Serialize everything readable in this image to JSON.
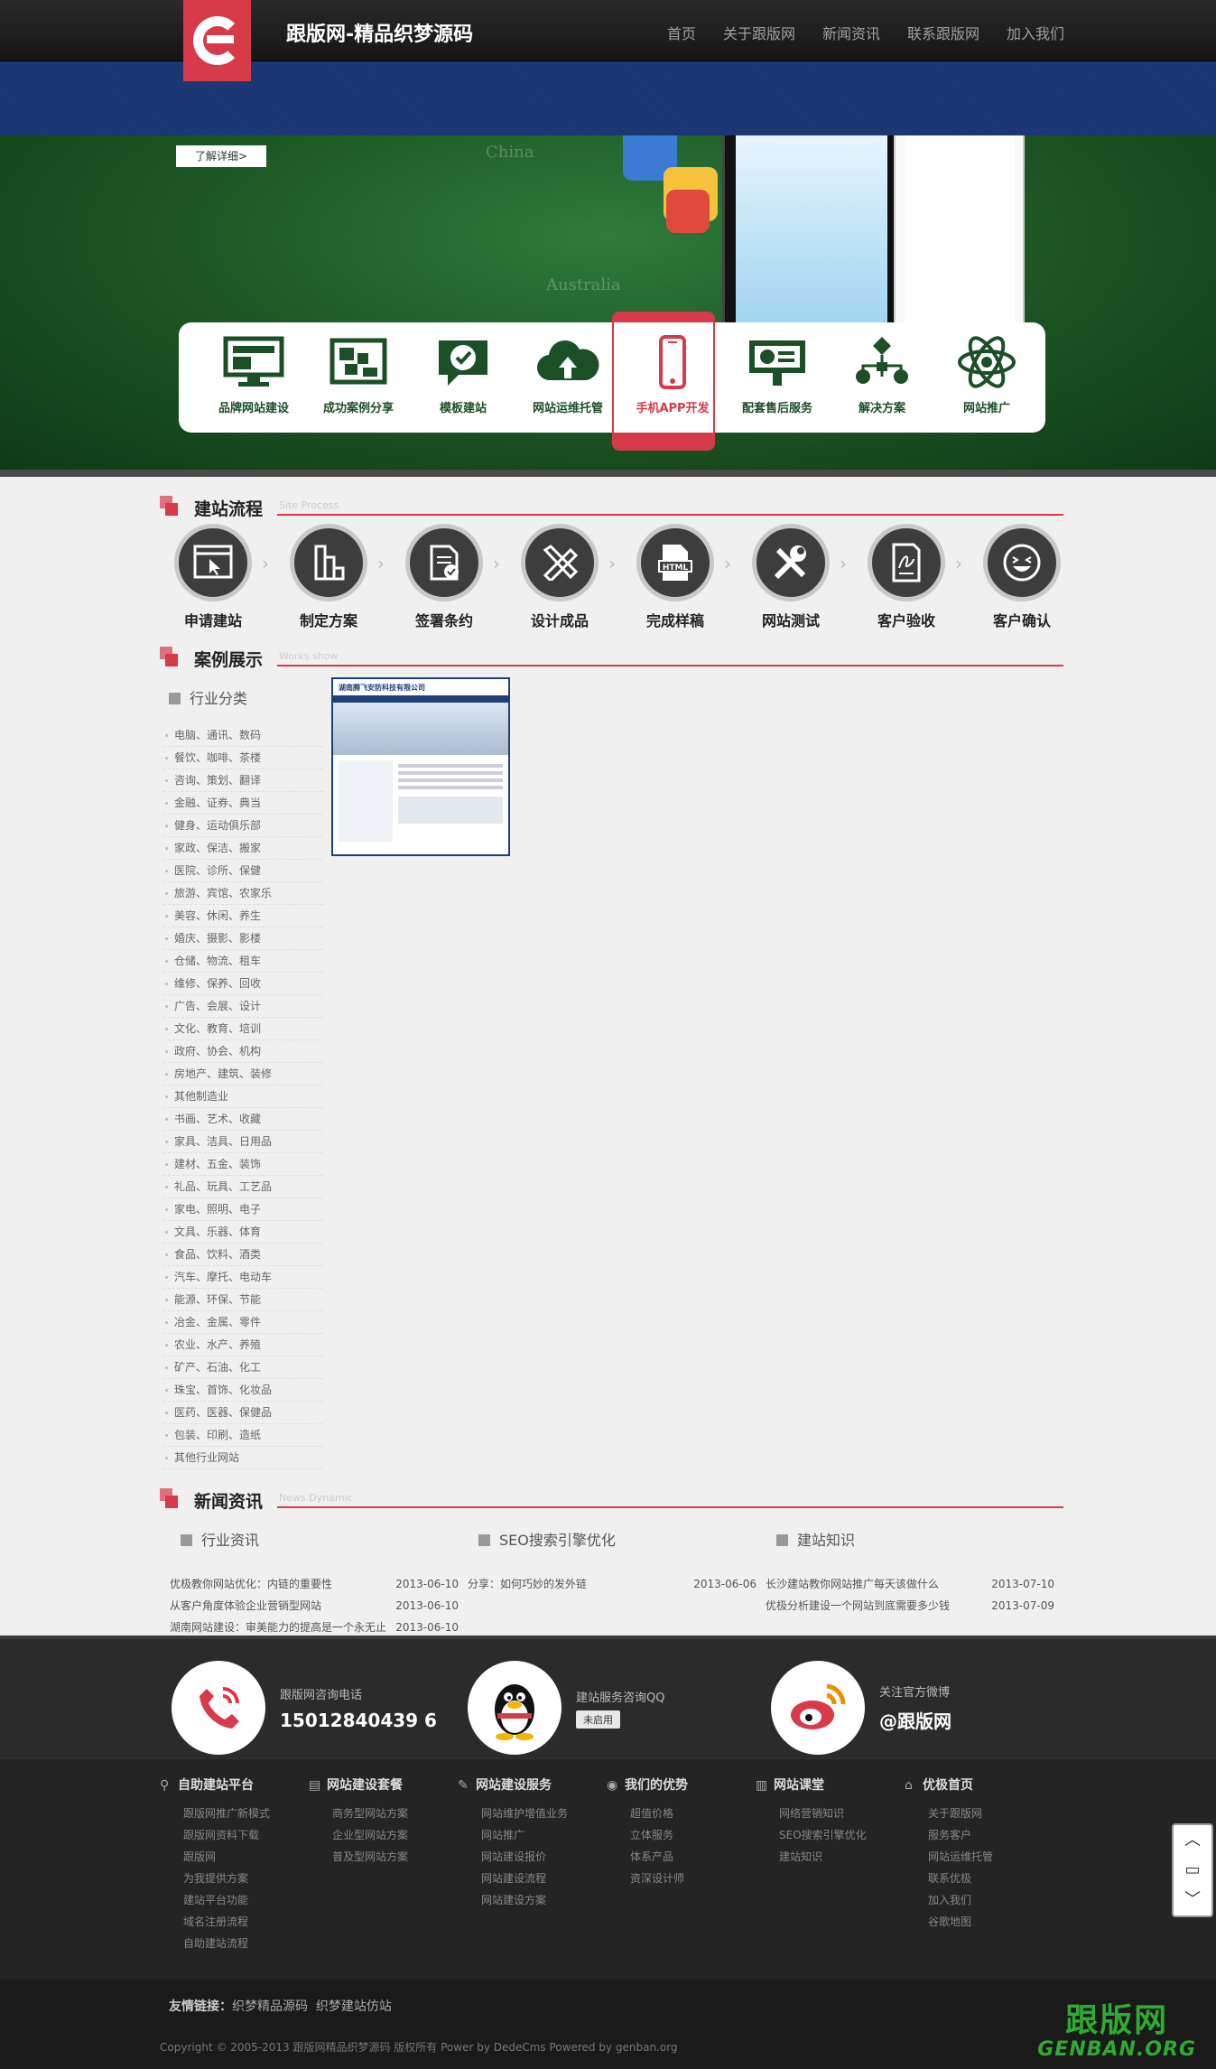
{
  "header": {
    "site_title": "跟版网-精品织梦源码",
    "nav": [
      "首页",
      "关于跟版网",
      "新闻资讯",
      "联系跟版网",
      "加入我们"
    ]
  },
  "banner": {
    "more_button": "了解详细>",
    "map_labels": [
      "China",
      "Australia"
    ]
  },
  "services": [
    {
      "label": "品牌网站建设",
      "icon": "monitor-icon"
    },
    {
      "label": "成功案例分享",
      "icon": "gallery-icon"
    },
    {
      "label": "模板建站",
      "icon": "chat-check-icon"
    },
    {
      "label": "网站运维托管",
      "icon": "cloud-upload-icon"
    },
    {
      "label": "手机APP开发",
      "icon": "phone-icon",
      "active": true
    },
    {
      "label": "配套售后服务",
      "icon": "presentation-icon"
    },
    {
      "label": "解决方案",
      "icon": "flowchart-icon"
    },
    {
      "label": "网站推广",
      "icon": "atom-icon"
    }
  ],
  "process_section": {
    "title": "建站流程",
    "subtitle": "Site Process",
    "steps": [
      {
        "label": "申请建站",
        "icon": "browser-cursor-icon"
      },
      {
        "label": "制定方案",
        "icon": "blocks-icon"
      },
      {
        "label": "签署条约",
        "icon": "document-check-icon"
      },
      {
        "label": "设计成品",
        "icon": "pencil-ruler-icon"
      },
      {
        "label": "完成样稿",
        "icon": "html-file-icon"
      },
      {
        "label": "网站测试",
        "icon": "tools-icon"
      },
      {
        "label": "客户验收",
        "icon": "signature-icon"
      },
      {
        "label": "客户确认",
        "icon": "smile-icon"
      }
    ]
  },
  "works_section": {
    "title": "案例展示",
    "subtitle": "Works show",
    "category_heading": "行业分类",
    "categories": [
      "电脑、通讯、数码",
      "餐饮、咖啡、茶楼",
      "咨询、策划、翻译",
      "金融、证券、典当",
      "健身、运动俱乐部",
      "家政、保洁、搬家",
      "医院、诊所、保健",
      "旅游、宾馆、农家乐",
      "美容、休闲、养生",
      "婚庆、摄影、影楼",
      "仓储、物流、租车",
      "维修、保养、回收",
      "广告、会展、设计",
      "文化、教育、培训",
      "政府、协会、机构",
      "房地产、建筑、装修",
      "其他制造业",
      "书画、艺术、收藏",
      "家具、洁具、日用品",
      "建材、五金、装饰",
      "礼品、玩具、工艺品",
      "家电、照明、电子",
      "文具、乐器、体育",
      "食品、饮料、酒类",
      "汽车、摩托、电动车",
      "能源、环保、节能",
      "冶金、金属、零件",
      "农业、水产、养殖",
      "矿产、石油、化工",
      "珠宝、首饰、化妆品",
      "医药、医器、保健品",
      "包装、印刷、造纸",
      "其他行业网站"
    ],
    "thumb_company": "湖南腾飞安防科技有限公司"
  },
  "news_section": {
    "title": "新闻资讯",
    "subtitle": "News Dynamic",
    "columns": [
      {
        "heading": "行业资讯",
        "items": [
          {
            "title": "优极教你网站优化：内链的重要性",
            "date": "2013-06-10"
          },
          {
            "title": "从客户角度体验企业营销型网站",
            "date": "2013-06-10"
          },
          {
            "title": "湖南网站建设：审美能力的提高是一个永无止",
            "date": "2013-06-10"
          }
        ]
      },
      {
        "heading": "SEO搜索引擎优化",
        "items": [
          {
            "title": "分享：如何巧妙的发外链",
            "date": "2013-06-06"
          }
        ]
      },
      {
        "heading": "建站知识",
        "items": [
          {
            "title": "长沙建站教你网站推广每天该做什么",
            "date": "2013-07-10"
          },
          {
            "title": "优极分析建设一个网站到底需要多少钱",
            "date": "2013-07-09"
          }
        ]
      }
    ]
  },
  "contacts": [
    {
      "label": "跟版网咨询电话",
      "value": "15012840439 6",
      "icon": "phone-handset-icon"
    },
    {
      "label": "建站服务咨询QQ",
      "button": "未启用",
      "icon": "qq-penguin-icon"
    },
    {
      "label": "关注官方微博",
      "value": "@跟版网",
      "icon": "weibo-icon"
    }
  ],
  "footer_columns": [
    {
      "heading": "自助建站平台",
      "icon": "link-icon",
      "items": [
        "跟版网推广新模式",
        "跟版网资料下载",
        "跟版网",
        "为我提供方案",
        "建站平台功能",
        "域名注册流程",
        "自助建站流程"
      ]
    },
    {
      "heading": "网站建设套餐",
      "icon": "doc-icon",
      "items": [
        "商务型网站方案",
        "企业型网站方案",
        "普及型网站方案"
      ]
    },
    {
      "heading": "网站建设服务",
      "icon": "edit-icon",
      "items": [
        "网站维护增值业务",
        "网站推广",
        "网站建设报价",
        "网站建设流程",
        "网站建设方案"
      ]
    },
    {
      "heading": "我们的优势",
      "icon": "eye-icon",
      "items": [
        "超值价格",
        "立体服务",
        "体系产品",
        "资深设计师"
      ]
    },
    {
      "heading": "网站课堂",
      "icon": "chart-icon",
      "items": [
        "网络营销知识",
        "SEO搜索引擎优化",
        "建站知识"
      ]
    },
    {
      "heading": "优极首页",
      "icon": "home-icon",
      "items": [
        "关于跟版网",
        "服务客户",
        "网站运维托管",
        "联系优极",
        "加入我们",
        "谷歌地图"
      ]
    }
  ],
  "footer_bottom": {
    "friend_label": "友情链接：",
    "friend_links": [
      "织梦精品源码",
      "织梦建站仿站"
    ],
    "copyright": "Copyright © 2005-2013 跟版网精品织梦源码 版权所有 Power by DedeCms Powered by genban.org",
    "watermark_cn": "跟版网",
    "watermark_en": "GENBAN.ORG"
  },
  "colors": {
    "accent": "#d73a49",
    "green": "#1b4f25",
    "dark": "#2b2b2b"
  }
}
